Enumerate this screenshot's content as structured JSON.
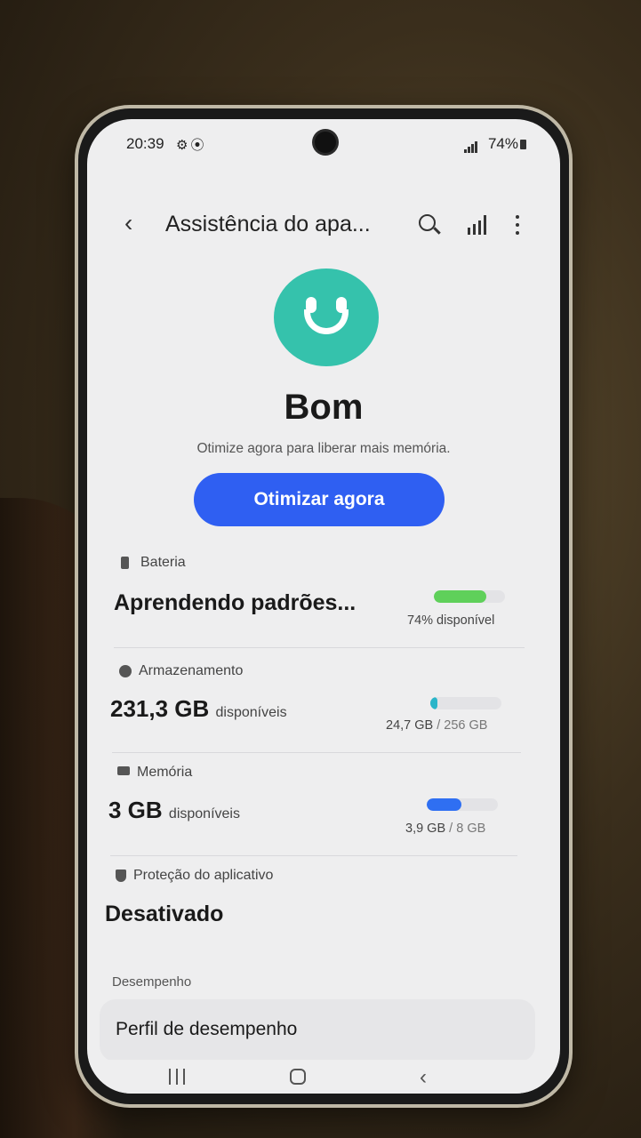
{
  "status_bar": {
    "time": "20:39",
    "icons": [
      "gear-icon",
      "location-icon"
    ],
    "battery": "74%"
  },
  "app_bar": {
    "title": "Assistência do apa...",
    "back": "‹",
    "actions": [
      "search-icon",
      "stats-icon",
      "more-icon"
    ]
  },
  "health": {
    "state": "Bom",
    "message": "Otimize agora para liberar mais memória.",
    "button": "Otimizar agora",
    "accent": "#35c2ac"
  },
  "battery": {
    "label": "Bateria",
    "status": "Aprendendo padrões...",
    "detail": "74% disponível",
    "level": 0.74,
    "color": "#5fd05a"
  },
  "storage": {
    "label": "Armazenamento",
    "value": "231,3 GB",
    "unit": "disponíveis",
    "used": "24,7 GB",
    "separator": "/",
    "total": "256 GB",
    "used_fraction": 0.1,
    "color": "#2ab5c9"
  },
  "memory": {
    "label": "Memória",
    "value": "3 GB",
    "unit": "disponíveis",
    "used": "3,9 GB",
    "separator": "/",
    "total": "8 GB",
    "used_fraction": 0.49,
    "color": "#2f6ff2"
  },
  "app_protection": {
    "label": "Proteção do aplicativo",
    "status": "Desativado"
  },
  "performance": {
    "group": "Desempenho",
    "item": "Perfil de desempenho"
  },
  "button_color": "#2f5ff2"
}
